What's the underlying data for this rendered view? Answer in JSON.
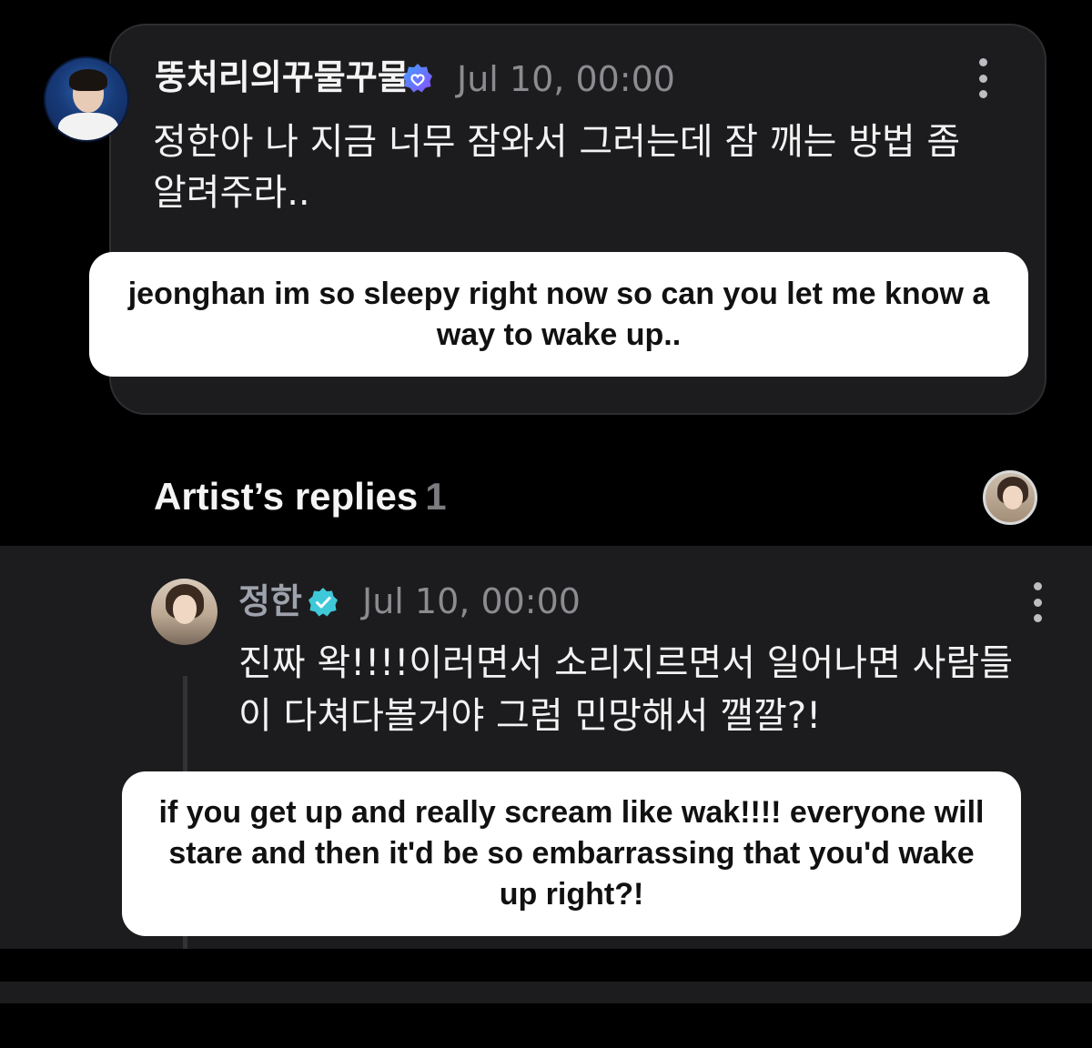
{
  "fan_post": {
    "author": "뚱처리의꾸물꾸물",
    "timestamp": "Jul 10, 00:00",
    "body": "정한아 나 지금 너무 잠와서 그러는데 잠 깨는 방법 좀 알려주라..",
    "translation": "jeonghan im so sleepy right now so can you let me know a way to wake up.."
  },
  "replies_section": {
    "title": "Artist’s replies",
    "count": "1"
  },
  "artist_reply": {
    "author": "정한",
    "timestamp": "Jul 10, 00:00",
    "body": "진짜 왁!!!!이러면서 소리지르면서 일어나면 사람들이 다쳐다볼거야 그럼 민망해서 깰깔?!",
    "translation": "if you get up and really scream like wak!!!! everyone will stare and then it'd be so embarrassing that you'd wake up right?!"
  },
  "colors": {
    "background": "#000000",
    "card": "#1c1c1e",
    "fan_badge": "#6a5cff",
    "artist_badge": "#3fc9d8",
    "muted_text": "#8b8b90"
  },
  "icons": {
    "fan_badge": "verified-badge-icon",
    "artist_badge": "verified-badge-icon",
    "more": "more-vertical-icon"
  }
}
